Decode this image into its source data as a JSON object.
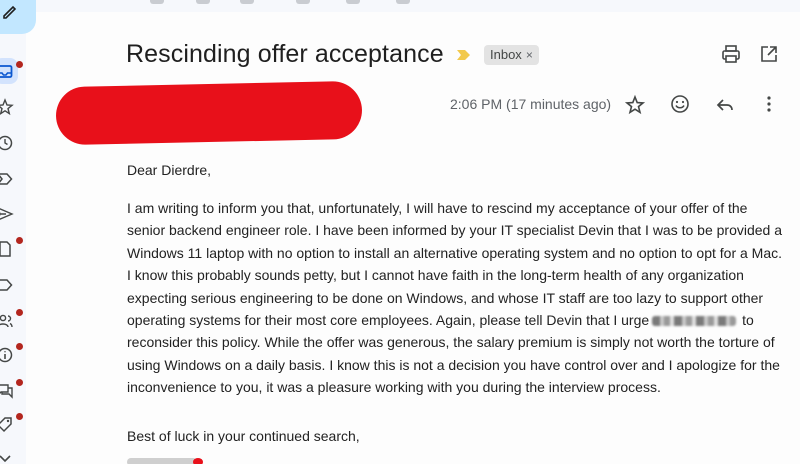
{
  "email": {
    "subject": "Rescinding offer acceptance",
    "label": "Inbox",
    "label_remove": "×",
    "timestamp": "2:06 PM (17 minutes ago)",
    "greeting": "Dear Dierdre,",
    "body_part1": "I am writing to inform you that, unfortunately, I will have to rescind my acceptance of your offer of the senior backend engineer role. I have been informed by your IT specialist Devin that I was to be provided a Windows 11 laptop with no option to install an alternative operating system and no option to opt for a Mac. I know this probably sounds petty, but I cannot have faith in the long-term health of any organization expecting serious engineering to be done on Windows, and whose IT staff are too lazy to support other operating systems for their most core employees. Again, please tell Devin that I urge",
    "body_part2": "to reconsider this policy. While the offer was generous, the salary premium is simply not worth the torture of using Windows on a daily basis. I know this is not a decision you have control over and I apologize for the inconvenience to you, it was a pleasure working with you during the interview process.",
    "closing": "Best of luck in your continued search,"
  },
  "colors": {
    "redaction": "#e8101a",
    "compose": "#c2e7ff",
    "notification_dot": "#b3261e",
    "importance": "#f2c94c"
  },
  "icons": [
    "compose-pencil-icon",
    "inbox-icon",
    "star-icon",
    "clock-icon",
    "label-important-icon",
    "send-icon",
    "draft-icon",
    "label-icon",
    "people-icon",
    "info-icon",
    "forum-icon",
    "tag-icon",
    "chevron-down-icon",
    "print-icon",
    "open-new-window-icon",
    "star-outline-icon",
    "emoji-icon",
    "reply-icon",
    "more-vert-icon"
  ]
}
